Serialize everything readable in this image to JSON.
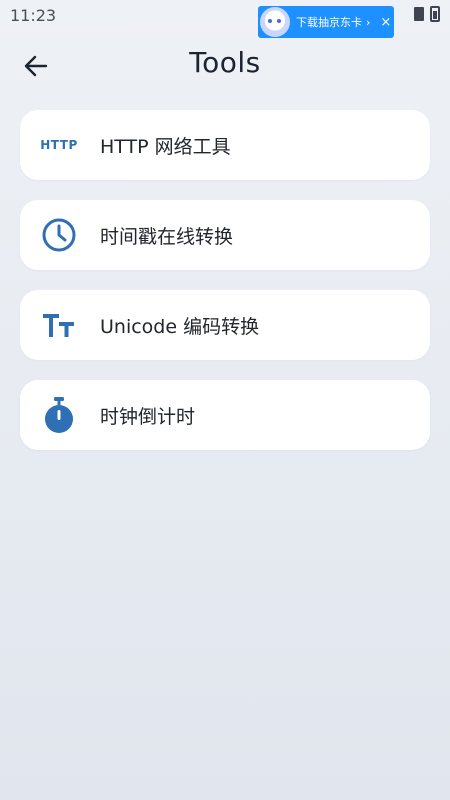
{
  "status_bar": {
    "time": "11:23"
  },
  "ad": {
    "text": "下载抽京东卡",
    "arrow": "›",
    "close": "×"
  },
  "header": {
    "title": "Tools"
  },
  "tools": [
    {
      "label": "HTTP 网络工具",
      "icon": "http-icon",
      "icon_text": "HTTP"
    },
    {
      "label": "时间戳在线转换",
      "icon": "clock-icon"
    },
    {
      "label": "Unicode 编码转换",
      "icon": "text-size-icon"
    },
    {
      "label": "时钟倒计时",
      "icon": "stopwatch-icon"
    }
  ],
  "colors": {
    "accent": "#2f6fb3",
    "card": "#ffffff",
    "background": "#e9edf3"
  }
}
